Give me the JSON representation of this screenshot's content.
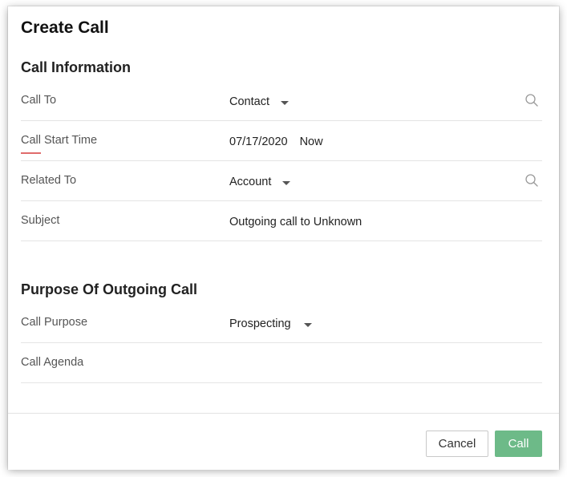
{
  "dialog": {
    "title": "Create Call"
  },
  "sections": {
    "call_information": "Call Information",
    "purpose": "Purpose Of Outgoing Call"
  },
  "fields": {
    "call_to": {
      "label": "Call To",
      "value": "Contact"
    },
    "call_start_time": {
      "label": "Call Start Time",
      "date": "07/17/2020",
      "time": "Now"
    },
    "related_to": {
      "label": "Related To",
      "value": "Account"
    },
    "subject": {
      "label": "Subject",
      "value": "Outgoing call to Unknown"
    },
    "call_purpose": {
      "label": "Call Purpose",
      "value": "Prospecting"
    },
    "call_agenda": {
      "label": "Call Agenda",
      "value": ""
    }
  },
  "footer": {
    "cancel_label": "Cancel",
    "call_label": "Call"
  },
  "colors": {
    "primary_button": "#6dba88",
    "focus_underline": "#e06b6b"
  },
  "icons": {
    "search": "search-icon",
    "dropdown": "caret-down-icon"
  }
}
